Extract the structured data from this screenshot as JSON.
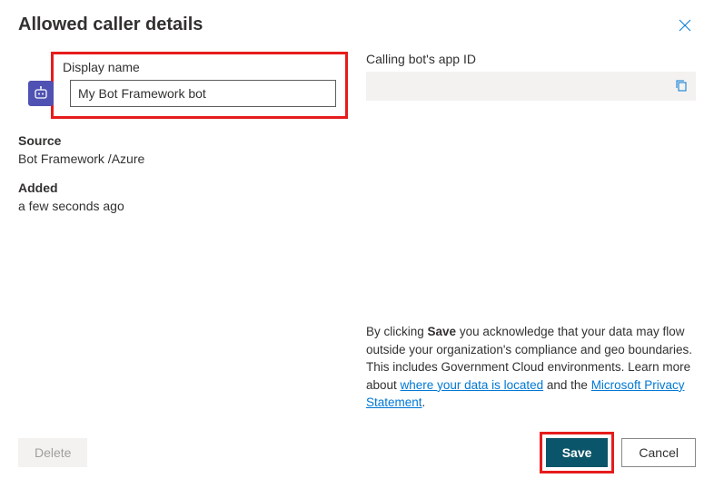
{
  "header": {
    "title": "Allowed caller details"
  },
  "left": {
    "display_name_label": "Display name",
    "display_name_value": "My Bot Framework bot",
    "source_label": "Source",
    "source_value": "Bot Framework /Azure",
    "added_label": "Added",
    "added_value": "a few seconds ago"
  },
  "right": {
    "app_id_label": "Calling bot's app ID",
    "app_id_value": ""
  },
  "disclosure": {
    "pre_text": "By clicking ",
    "save_word": "Save",
    "mid_text": " you acknowledge that your data may flow outside your organization's compliance and geo boundaries. This includes Government Cloud environments. Learn more about ",
    "link1": "where your data is located",
    "between_links": " and the ",
    "link2": "Microsoft Privacy Statement",
    "period": "."
  },
  "footer": {
    "delete_label": "Delete",
    "save_label": "Save",
    "cancel_label": "Cancel"
  }
}
